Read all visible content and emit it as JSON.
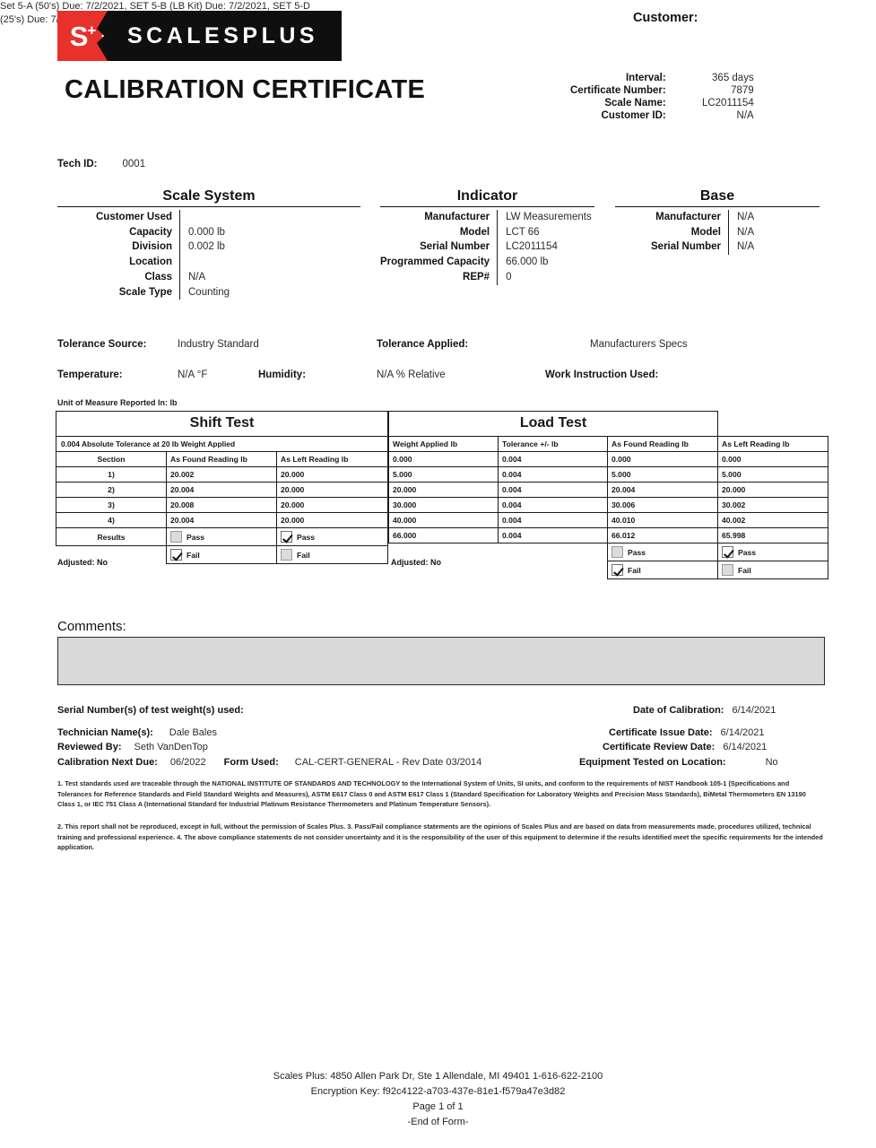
{
  "brand": {
    "mark_letter": "S",
    "mark_sup": "+",
    "name": "SCALESPLUS",
    "red": "#e8312a",
    "black": "#100f0f"
  },
  "header": {
    "doc_title": "CALIBRATION CERTIFICATE",
    "customer_label": "Customer:",
    "meta": [
      {
        "label": "Interval:",
        "value": "365 days"
      },
      {
        "label": "Certificate Number:",
        "value": "7879"
      },
      {
        "label": "Scale Name:",
        "value": "LC2011154"
      },
      {
        "label": "Customer ID:",
        "value": "N/A"
      }
    ]
  },
  "tech": {
    "label": "Tech ID:",
    "value": "0001"
  },
  "panels": {
    "scale_system": {
      "title": "Scale System",
      "rows": [
        {
          "label": "Customer Used",
          "value": ""
        },
        {
          "label": "Capacity",
          "value": "0.000 lb"
        },
        {
          "label": "Division",
          "value": "0.002 lb"
        },
        {
          "label": "Location",
          "value": ""
        },
        {
          "label": "Class",
          "value": "N/A"
        },
        {
          "label": "Scale Type",
          "value": "Counting"
        }
      ]
    },
    "indicator": {
      "title": "Indicator",
      "rows": [
        {
          "label": "Manufacturer",
          "value": "LW Measurements"
        },
        {
          "label": "Model",
          "value": "LCT 66"
        },
        {
          "label": "Serial Number",
          "value": "LC2011154"
        },
        {
          "label": "Programmed Capacity",
          "value": "66.000 lb"
        },
        {
          "label": "REP#",
          "value": "0"
        }
      ]
    },
    "base": {
      "title": "Base",
      "rows": [
        {
          "label": "Manufacturer",
          "value": "N/A"
        },
        {
          "label": "Model",
          "value": "N/A"
        },
        {
          "label": "Serial Number",
          "value": "N/A"
        }
      ]
    }
  },
  "conditions": {
    "tolerance_source_label": "Tolerance Source:",
    "tolerance_source_value": "Industry Standard",
    "tolerance_applied_label": "Tolerance Applied:",
    "tolerance_applied_value": "Manufacturers Specs",
    "temperature_label": "Temperature:",
    "temperature_value": "N/A °F",
    "humidity_label": "Humidity:",
    "humidity_value": "N/A % Relative",
    "work_instruction_label": "Work Instruction Used:",
    "work_instruction_value": "",
    "unit_of_measure": "Unit of Measure Reported In: lb"
  },
  "shift_test": {
    "title": "Shift Test",
    "subtitle": "0.004 Absolute Tolerance at 20 lb Weight Applied",
    "columns": [
      "Section",
      "As Found Reading lb",
      "As Left Reading lb"
    ],
    "rows": [
      {
        "section": "1)",
        "as_found": "20.002",
        "as_left": "20.000"
      },
      {
        "section": "2)",
        "as_found": "20.004",
        "as_left": "20.000"
      },
      {
        "section": "3)",
        "as_found": "20.008",
        "as_left": "20.000"
      },
      {
        "section": "4)",
        "as_found": "20.004",
        "as_left": "20.000"
      }
    ],
    "results_label": "Results",
    "pass_label": "Pass",
    "fail_label": "Fail",
    "as_found_pass": false,
    "as_found_fail": true,
    "as_left_pass": true,
    "as_left_fail": false,
    "adjusted": "Adjusted: No"
  },
  "load_test": {
    "title": "Load Test",
    "columns": [
      "Weight Applied lb",
      "Tolerance +/- lb",
      "As Found Reading lb",
      "As Left Reading lb"
    ],
    "rows": [
      {
        "weight": "0.000",
        "tolerance": "0.004",
        "as_found": "0.000",
        "as_left": "0.000"
      },
      {
        "weight": "5.000",
        "tolerance": "0.004",
        "as_found": "5.000",
        "as_left": "5.000"
      },
      {
        "weight": "20.000",
        "tolerance": "0.004",
        "as_found": "20.004",
        "as_left": "20.000"
      },
      {
        "weight": "30.000",
        "tolerance": "0.004",
        "as_found": "30.006",
        "as_left": "30.002"
      },
      {
        "weight": "40.000",
        "tolerance": "0.004",
        "as_found": "40.010",
        "as_left": "40.002"
      },
      {
        "weight": "66.000",
        "tolerance": "0.004",
        "as_found": "66.012",
        "as_left": "65.998"
      }
    ],
    "pass_label": "Pass",
    "fail_label": "Fail",
    "as_found_pass": false,
    "as_found_fail": true,
    "as_left_pass": true,
    "as_left_fail": false,
    "adjusted": "Adjusted: No"
  },
  "comments": {
    "label": "Comments:",
    "value": ""
  },
  "footer_details": {
    "serial_numbers_label": "Serial Number(s) of test weight(s) used:",
    "serial_numbers_value": "Set 5-A (50's) Due: 7/2/2021, SET 5-B (LB Kit) Due: 7/2/2021, SET 5-D (25's) Due: 7/2/2021",
    "technician_label": "Technician Name(s):",
    "technician_value": "Dale Bales",
    "reviewed_by_label": "Reviewed By:",
    "reviewed_by_value": "Seth VanDenTop",
    "next_due_label": "Calibration Next Due:",
    "next_due_value": "06/2022",
    "form_used_label": "Form Used:",
    "form_used_value": "CAL-CERT-GENERAL - Rev Date 03/2014",
    "date_of_calibration_label": "Date of Calibration:",
    "date_of_calibration_value": "6/14/2021",
    "issue_date_label": "Certificate Issue Date:",
    "issue_date_value": "6/14/2021",
    "review_date_label": "Certificate Review Date:",
    "review_date_value": "6/14/2021",
    "tested_on_location_label": "Equipment Tested on Location:",
    "tested_on_location_value": "No"
  },
  "legal": {
    "paragraph_1": "1. Test standards used are traceable through the NATIONAL INSTITUTE OF STANDARDS AND TECHNOLOGY to the International System of Units, SI units, and conform to the requirements of NIST Handbook 105-1 (Specifications and Tolerances for Reference Standards and Field Standard Weights and Measures), ASTM E617 Class 0 and ASTM E617 Class 1 (Standard Specification for Laboratory Weights and Precision Mass Standards), BiMetal Thermometers EN 13190 Class 1, or IEC 751 Class A (International Standard for Industrial Platinum Resistance Thermometers and Platinum Temperature Sensors).",
    "paragraph_2": "2. This report shall not be reproduced, except in full, without the permission of Scales Plus. 3. Pass/Fail compliance statements are the opinions of Scales Plus and are based on data from measurements made, procedures utilized, technical training and professional experience. 4. The above compliance statements do not consider uncertainty and it is the responsibility of the user of this equipment to determine if the results identified meet the specific requirements for the intended application."
  },
  "page_footer": {
    "address": "Scales Plus: 4850 Allen Park Dr, Ste 1 Allendale, MI 49401 1-616-622-2100",
    "encryption_key": "Encryption Key: f92c4122-a703-437e-81e1-f579a47e3d82",
    "page_number": "Page 1 of 1",
    "end_of_form": "-End of Form-"
  }
}
